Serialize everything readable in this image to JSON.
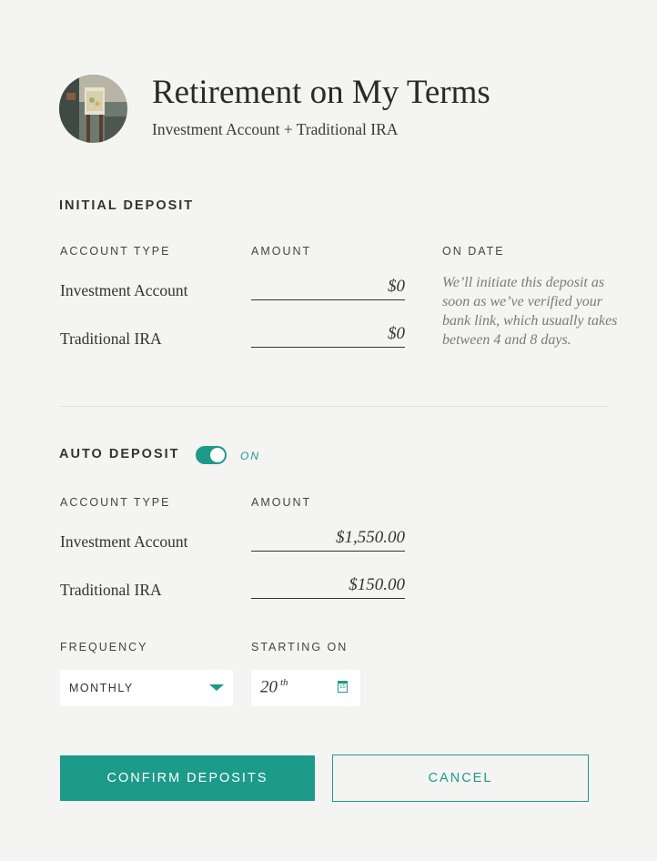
{
  "header": {
    "title": "Retirement on My Terms",
    "subtitle": "Investment Account + Traditional IRA"
  },
  "initial_deposit": {
    "heading": "INITIAL DEPOSIT",
    "col_account_type": "ACCOUNT TYPE",
    "col_amount": "AMOUNT",
    "col_on_date": "ON DATE",
    "rows": [
      {
        "account": "Investment Account",
        "amount": "$0"
      },
      {
        "account": "Traditional IRA",
        "amount": "$0"
      }
    ],
    "note": "We’ll initiate this deposit as soon as we’ve verified your bank link, which usually takes between 4 and 8 days."
  },
  "auto_deposit": {
    "heading": "AUTO DEPOSIT",
    "toggle_state": "ON",
    "col_account_type": "ACCOUNT TYPE",
    "col_amount": "AMOUNT",
    "rows": [
      {
        "account": "Investment Account",
        "amount": "$1,550.00"
      },
      {
        "account": "Traditional IRA",
        "amount": "$150.00"
      }
    ],
    "frequency_label": "FREQUENCY",
    "frequency_value": "MONTHLY",
    "starting_label": "STARTING ON",
    "starting_day": "20",
    "starting_suffix": "th",
    "calendar_icon_number": "15"
  },
  "actions": {
    "confirm": "CONFIRM DEPOSITS",
    "cancel": "CANCEL"
  },
  "colors": {
    "accent": "#1c9a8a",
    "background": "#f4f4f3"
  },
  "icons": {
    "frequency_dropdown": "chevron-down-icon",
    "date_picker": "calendar-icon"
  }
}
